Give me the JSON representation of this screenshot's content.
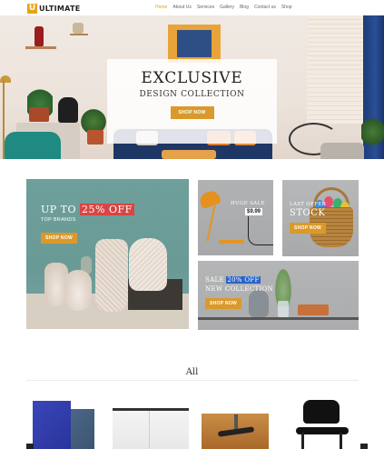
{
  "brand": {
    "logo_letter": "U",
    "name": "ULTIMATE",
    "accent": "#e8a21a"
  },
  "nav": {
    "items": [
      {
        "label": "Home",
        "active": true
      },
      {
        "label": "About Us",
        "active": false
      },
      {
        "label": "Services",
        "active": false
      },
      {
        "label": "Gallery",
        "active": false
      },
      {
        "label": "Blog",
        "active": false
      },
      {
        "label": "Contact us",
        "active": false
      },
      {
        "label": "Shop",
        "active": false
      }
    ]
  },
  "hero": {
    "title": "EXCLUSIVE",
    "subtitle": "DESIGN COLLECTION",
    "button": "SHOP NOW"
  },
  "promos": {
    "vases": {
      "title_prefix": "UP TO",
      "title_badge": "25% OFF",
      "subtitle": "TOP BRANDS",
      "button": "SHOP NOW"
    },
    "lamp": {
      "title": "HUGE SALE",
      "price": "$9.99"
    },
    "basket": {
      "title": "LAST OFFER",
      "big": "STOCK",
      "button": "SHOP NOW"
    },
    "collection": {
      "title_prefix": "SALE",
      "title_badge": "20% OFF",
      "subtitle": "NEW COLLECTION",
      "button": "SHOP NOW"
    }
  },
  "section": {
    "title": "All"
  },
  "products": [
    {
      "icon": "office-boards-image"
    },
    {
      "icon": "white-cabinet-image"
    },
    {
      "icon": "office-chair-base-image"
    },
    {
      "icon": "black-chair-image"
    }
  ],
  "colors": {
    "accent": "#d99a2b",
    "badge_red": "#d84545",
    "badge_blue": "#2a63c8",
    "teal_panel": "#6e9f9b"
  }
}
